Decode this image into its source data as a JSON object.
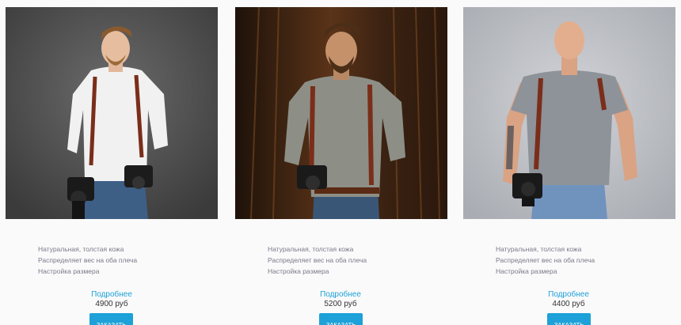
{
  "products": [
    {
      "features": [
        "Натуральная, толстая кожа",
        "Распределяет вес на оба плеча",
        "Настройка размера"
      ],
      "more_label": "Подробнее",
      "price": "4900 руб",
      "order_label": "ЗАКАЗАТЬ"
    },
    {
      "features": [
        "Натуральная, толстая кожа",
        "Распределяет вес на оба плеча",
        "Настройка размера"
      ],
      "more_label": "Подробнее",
      "price": "5200 руб",
      "order_label": "ЗАКАЗАТЬ"
    },
    {
      "features": [
        "Натуральная, толстая кожа",
        "Распределяет вес на оба плеча",
        "Настройка размера"
      ],
      "more_label": "Подробнее",
      "price": "4400 руб",
      "order_label": "ЗАКАЗАТЬ"
    }
  ],
  "colors": {
    "accent": "#1da1d8",
    "feature_text": "#7a7a8c",
    "price_text": "#333333",
    "strap_leather": "#7a2e1a"
  }
}
